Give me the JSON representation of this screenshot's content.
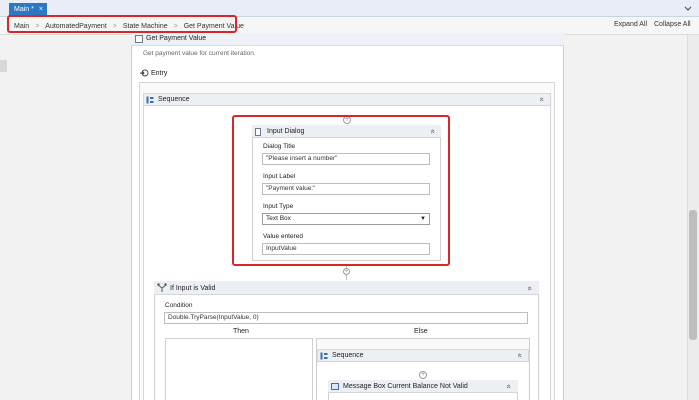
{
  "tabs": [
    {
      "label": "Main *",
      "close": "×"
    }
  ],
  "breadcrumb": [
    "Main",
    "AutomatedPayment",
    "State Machine",
    "Get Payment Value"
  ],
  "breadcrumb_sep": ">",
  "toolbar": {
    "expand_all": "Expand All",
    "collapse_all": "Collapse All"
  },
  "state": {
    "title": "Get Payment Value",
    "description": "Get payment value for current iteration.",
    "entry_label": "Entry"
  },
  "sequence": {
    "label": "Sequence",
    "collapse": "«"
  },
  "input_dialog": {
    "title": "Input Dialog",
    "fields": {
      "dialog_title": {
        "label": "Dialog Title",
        "value": "\"Please insert a number\""
      },
      "input_label": {
        "label": "Input Label",
        "value": "\"Payment value:\""
      },
      "input_type": {
        "label": "Input Type",
        "value": "Text Box"
      },
      "value_entered": {
        "label": "Value entered",
        "value": "InputValue"
      }
    }
  },
  "if_activity": {
    "title": "If Input is Valid",
    "condition_label": "Condition",
    "condition_value": "Double.TryParse(InputValue, 0)",
    "then_label": "Then",
    "else_label": "Else"
  },
  "else_sequence": {
    "label": "Sequence"
  },
  "message_box": {
    "title": "Message Box Current Balance Not Valid"
  },
  "icons": {
    "collapse": "chevron-double-up-icon",
    "plus": "add-activity-icon",
    "dropdown": "dropdown-arrow-icon"
  },
  "colors": {
    "tab_active": "#2b78c5",
    "highlight": "#d9262b"
  }
}
